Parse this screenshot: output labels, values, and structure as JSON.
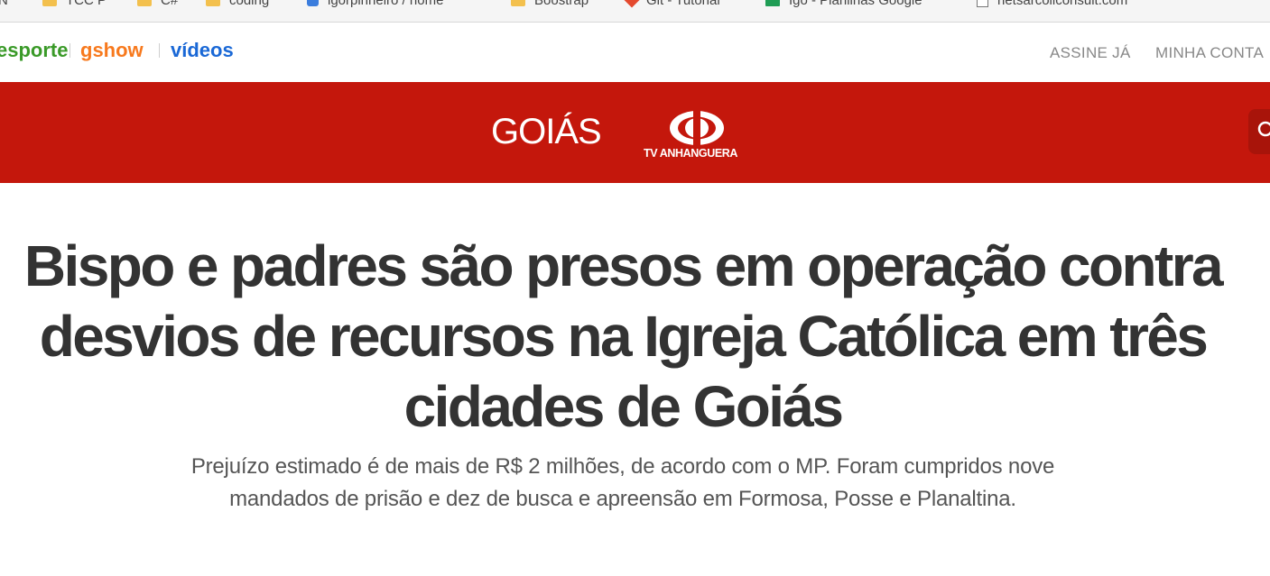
{
  "bookmarks": [
    {
      "label": "SN",
      "icon": "none"
    },
    {
      "label": "TCC P",
      "icon": "folder-icon"
    },
    {
      "label": "C#",
      "icon": "folder-icon"
    },
    {
      "label": "coding",
      "icon": "folder-icon"
    },
    {
      "label": "igorpinheiro / home",
      "icon": "bitbucket-icon"
    },
    {
      "label": "Boostrap",
      "icon": "folder-icon"
    },
    {
      "label": "Git - Tutorial",
      "icon": "git-icon"
    },
    {
      "label": "Igo - Planilhas Google",
      "icon": "sheets-icon"
    },
    {
      "label": "netsarcoliconsult.com",
      "icon": "page-icon"
    }
  ],
  "nav": {
    "esporte": "esporte",
    "gshow": "gshow",
    "videos": "vídeos",
    "assine": "ASSINE JÁ",
    "conta": "MINHA CONTA",
    "colors": {
      "esporte": "#3a9a28",
      "gshow": "#f7791d",
      "videos": "#1a68d6"
    }
  },
  "header": {
    "region": "GOIÁS",
    "affiliate": "TV ANHANGUERA",
    "bar_color": "#c4170c"
  },
  "article": {
    "headline": "Bispo e padres são presos em operação contra desvios de recursos na Igreja Católica em três cidades de Goiás",
    "subtitle": "Prejuízo estimado é de mais de R$ 2 milhões, de acordo com o MP. Foram cumpridos nove mandados de prisão e dez de busca e apreensão em Formosa, Posse e Planaltina."
  }
}
